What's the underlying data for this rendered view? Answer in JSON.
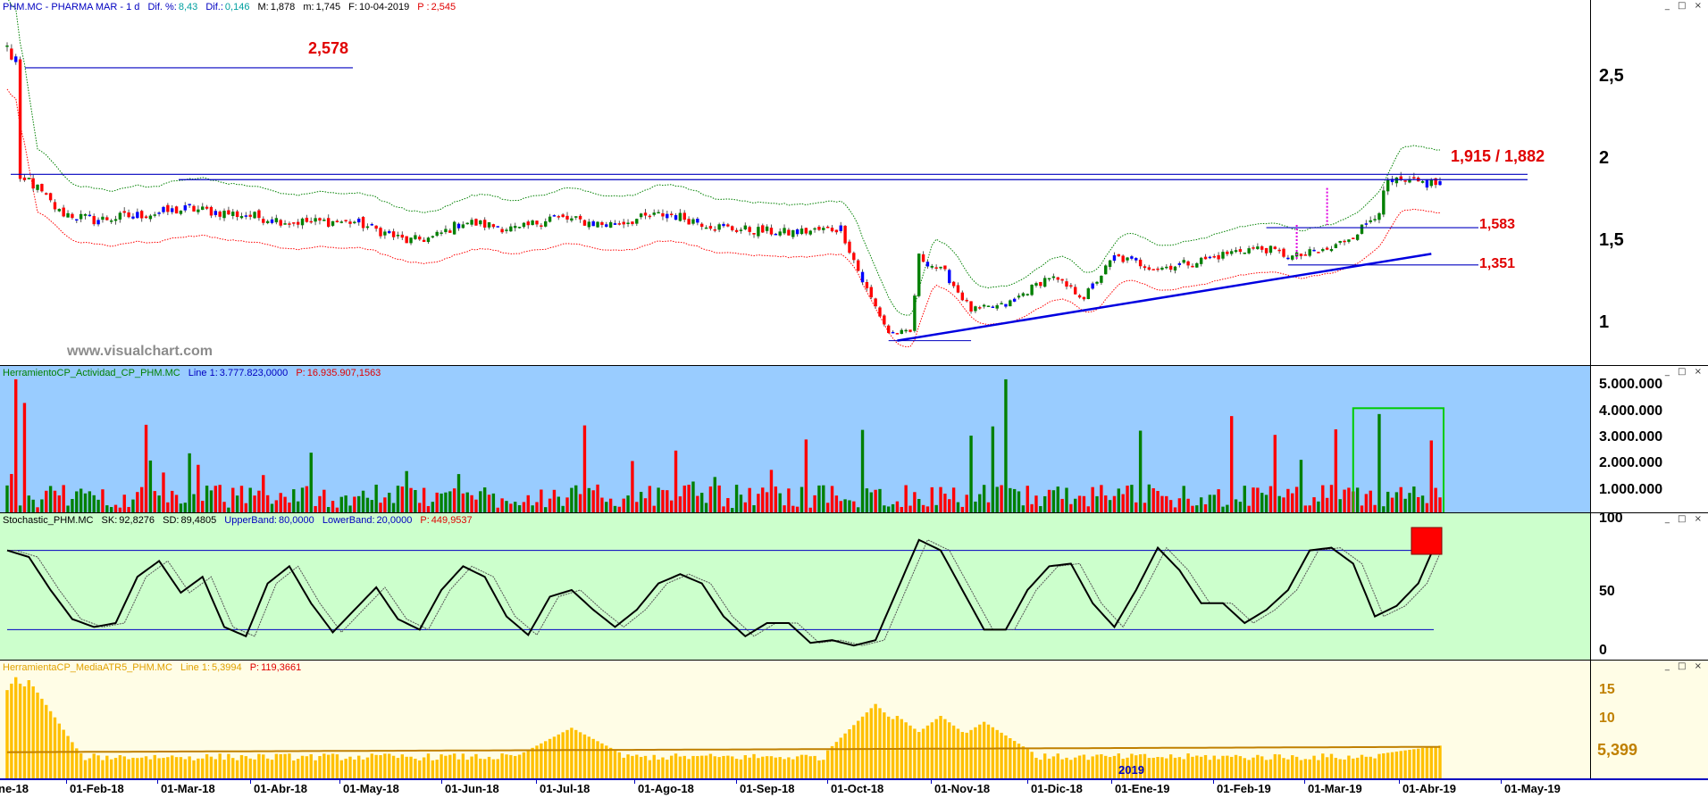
{
  "panes": {
    "price": {
      "symbol": "PHM.MC - PHARMA MAR -  1 d",
      "dif_label": "Dif. %:",
      "dif_pct": "8,43",
      "dif_abs_label": "Dif.:",
      "dif_abs": "0,146",
      "max_label": "M:",
      "max": "1,878",
      "min_label": "m:",
      "min": "1,745",
      "date_label": "F:",
      "date": "10-04-2019",
      "price_label": "P :",
      "price": "2,545",
      "watermark": "www.visualchart.com",
      "levels": {
        "top": "2,578",
        "resistance": "1,915 / 1,882",
        "mid": "1,583",
        "low": "1,351"
      },
      "y_ticks": [
        "2,5",
        "2",
        "1,5",
        "1"
      ]
    },
    "volume": {
      "name": "HerramientoCP_Actividad_CP_PHM.MC",
      "line_label": "Line 1:",
      "line_value": "3.777.823,0000",
      "p_label": "P:",
      "p_value": "16.935.907,1563",
      "y_ticks": [
        "5.000.000",
        "4.000.000",
        "3.000.000",
        "2.000.000",
        "1.000.000"
      ]
    },
    "stochastic": {
      "name": "Stochastic_PHM.MC",
      "sk_label": "SK:",
      "sk": "92,8276",
      "sd_label": "SD:",
      "sd": "89,4805",
      "ub_label": "UpperBand:",
      "ub": "80,0000",
      "lb_label": "LowerBand:",
      "lb": "20,0000",
      "p_label": "P:",
      "p": "449,9537",
      "y_ticks": [
        "100",
        "50",
        "0"
      ]
    },
    "atr": {
      "name": "HerramientaCP_MediaATR5_PHM.MC",
      "line_label": "Line 1:",
      "line_value": "5,3994",
      "p_label": "P:",
      "p_value": "119,3661",
      "y_ticks": [
        "15",
        "10",
        "5"
      ],
      "current": "5,399"
    }
  },
  "x_axis": {
    "labels": [
      "ne-18",
      "01-Feb-18",
      "01-Mar-18",
      "01-Abr-18",
      "01-May-18",
      "01-Jun-18",
      "01-Jul-18",
      "01-Ago-18",
      "01-Sep-18",
      "01-Oct-18",
      "01-Nov-18",
      "01-Dic-18",
      "01-Ene-19",
      "01-Feb-19",
      "01-Mar-19",
      "01-Abr-19",
      "01-May-19"
    ],
    "year_marker": "2019"
  },
  "window_buttons": "_ □ ×",
  "colors": {
    "price_bg": "#ffffff",
    "volume_bg": "#99ccff",
    "stoch_bg": "#ccffcc",
    "atr_bg": "#fffde6",
    "up": "#008000",
    "down": "#ff0000",
    "level_line": "#0000c0",
    "atr_bar": "#ffc000",
    "atr_line": "#c08000",
    "label_red": "#e00000"
  },
  "chart_data": [
    {
      "type": "candlestick",
      "title": "PHM.MC - PHARMA MAR -  1 d",
      "ylim": [
        0.75,
        2.9
      ],
      "y_ticks": [
        2.5,
        2.0,
        1.5,
        1.0
      ],
      "close_approx_path": [
        [
          0,
          2.7
        ],
        [
          2,
          2.6
        ],
        [
          3,
          1.85
        ],
        [
          5,
          1.88
        ],
        [
          12,
          1.68
        ],
        [
          20,
          1.63
        ],
        [
          30,
          1.66
        ],
        [
          42,
          1.7
        ],
        [
          55,
          1.66
        ],
        [
          65,
          1.62
        ],
        [
          80,
          1.62
        ],
        [
          92,
          1.5
        ],
        [
          98,
          1.52
        ],
        [
          105,
          1.62
        ],
        [
          118,
          1.57
        ],
        [
          125,
          1.65
        ],
        [
          138,
          1.6
        ],
        [
          152,
          1.67
        ],
        [
          165,
          1.58
        ],
        [
          180,
          1.55
        ],
        [
          192,
          1.58
        ],
        [
          197,
          1.25
        ],
        [
          203,
          0.93
        ],
        [
          208,
          0.93
        ],
        [
          210,
          1.4
        ],
        [
          216,
          1.3
        ],
        [
          222,
          1.07
        ],
        [
          230,
          1.1
        ],
        [
          240,
          1.28
        ],
        [
          248,
          1.15
        ],
        [
          255,
          1.4
        ],
        [
          265,
          1.33
        ],
        [
          275,
          1.38
        ],
        [
          285,
          1.45
        ],
        [
          290,
          1.45
        ],
        [
          296,
          1.4
        ],
        [
          305,
          1.45
        ],
        [
          312,
          1.58
        ],
        [
          316,
          1.7
        ],
        [
          318,
          1.86
        ]
      ],
      "levels": [
        2.578,
        1.915,
        1.882,
        1.583,
        1.351
      ],
      "trendline": [
        [
          205,
          0.88
        ],
        [
          328,
          1.42
        ]
      ]
    },
    {
      "type": "bar",
      "title": "HerramientoCP_Actividad_CP_PHM.MC",
      "ylim": [
        0,
        5200000
      ],
      "y_ticks": [
        5000000,
        4000000,
        3000000,
        2000000,
        1000000
      ],
      "last_value": 3777823,
      "notable_peaks": [
        [
          2,
          5100000
        ],
        [
          4,
          4200000
        ],
        [
          230,
          5100000
        ],
        [
          282,
          3700000
        ],
        [
          316,
          3777823
        ]
      ]
    },
    {
      "type": "line",
      "title": "Stochastic_PHM.MC",
      "ylim": [
        0,
        100
      ],
      "bands": [
        80,
        20
      ],
      "series": [
        {
          "name": "SK",
          "last": 92.8276
        },
        {
          "name": "SD",
          "last": 89.4805
        }
      ],
      "sk_path": [
        [
          0,
          80
        ],
        [
          5,
          75
        ],
        [
          10,
          50
        ],
        [
          15,
          28
        ],
        [
          20,
          22
        ],
        [
          25,
          25
        ],
        [
          30,
          60
        ],
        [
          35,
          72
        ],
        [
          40,
          48
        ],
        [
          45,
          60
        ],
        [
          50,
          22
        ],
        [
          55,
          15
        ],
        [
          60,
          55
        ],
        [
          65,
          68
        ],
        [
          70,
          40
        ],
        [
          75,
          18
        ],
        [
          80,
          35
        ],
        [
          85,
          52
        ],
        [
          90,
          28
        ],
        [
          95,
          20
        ],
        [
          100,
          50
        ],
        [
          105,
          68
        ],
        [
          110,
          60
        ],
        [
          115,
          30
        ],
        [
          120,
          16
        ],
        [
          125,
          45
        ],
        [
          130,
          50
        ],
        [
          135,
          35
        ],
        [
          140,
          22
        ],
        [
          145,
          35
        ],
        [
          150,
          55
        ],
        [
          155,
          62
        ],
        [
          160,
          55
        ],
        [
          165,
          30
        ],
        [
          170,
          15
        ],
        [
          175,
          25
        ],
        [
          180,
          25
        ],
        [
          185,
          10
        ],
        [
          190,
          12
        ],
        [
          195,
          8
        ],
        [
          200,
          12
        ],
        [
          205,
          50
        ],
        [
          210,
          88
        ],
        [
          215,
          80
        ],
        [
          220,
          50
        ],
        [
          225,
          20
        ],
        [
          230,
          20
        ],
        [
          235,
          50
        ],
        [
          240,
          68
        ],
        [
          245,
          70
        ],
        [
          250,
          40
        ],
        [
          255,
          22
        ],
        [
          260,
          50
        ],
        [
          265,
          82
        ],
        [
          270,
          65
        ],
        [
          275,
          40
        ],
        [
          280,
          40
        ],
        [
          285,
          25
        ],
        [
          290,
          35
        ],
        [
          295,
          50
        ],
        [
          300,
          80
        ],
        [
          305,
          82
        ],
        [
          310,
          70
        ],
        [
          315,
          30
        ],
        [
          320,
          38
        ],
        [
          325,
          55
        ],
        [
          330,
          92.8
        ]
      ]
    },
    {
      "type": "bar",
      "title": "HerramientaCP_MediaATR5_PHM.MC",
      "ylim": [
        0,
        18
      ],
      "y_ticks": [
        15,
        10,
        5
      ],
      "last_value": 5.3994,
      "peaks": [
        [
          2,
          17
        ],
        [
          5,
          16.5
        ],
        [
          130,
          8.5
        ],
        [
          200,
          12.5
        ],
        [
          205,
          10.5
        ],
        [
          215,
          10.5
        ],
        [
          225,
          9.5
        ]
      ]
    }
  ]
}
